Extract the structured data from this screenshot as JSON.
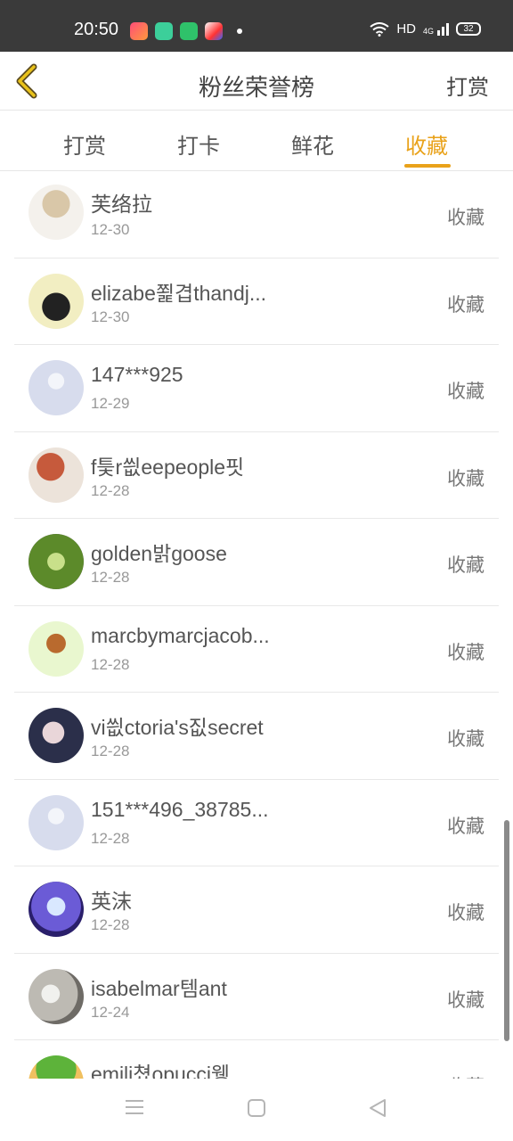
{
  "status_bar": {
    "time": "20:50",
    "network": "HD",
    "signal": "4G",
    "battery": "32",
    "app_icons": [
      "video-app-icon",
      "cart-app-icon",
      "circle-app-icon",
      "tiktok-app-icon"
    ]
  },
  "header": {
    "title": "粉丝荣誉榜",
    "action": "打赏"
  },
  "tabs": [
    {
      "label": "打赏",
      "active": false
    },
    {
      "label": "打卡",
      "active": false
    },
    {
      "label": "鲜花",
      "active": false
    },
    {
      "label": "收藏",
      "active": true
    }
  ],
  "accent_color": "#e9a21a",
  "list": [
    {
      "name": "芙络拉",
      "date": "12-30",
      "action": "收藏"
    },
    {
      "name": "elizabe쬝겹thandj...",
      "date": "12-30",
      "action": "收藏"
    },
    {
      "name": "147***925",
      "date": "12-29",
      "action": "收藏"
    },
    {
      "name": "f틏r씞eepeople핏",
      "date": "12-28",
      "action": "收藏"
    },
    {
      "name": "golden밝goose",
      "date": "12-28",
      "action": "收藏"
    },
    {
      "name": "marcbymarcjacob...",
      "date": "12-28",
      "action": "收藏"
    },
    {
      "name": "vi씞ctoria's짒secret",
      "date": "12-28",
      "action": "收藏"
    },
    {
      "name": "151***496_38785...",
      "date": "12-28",
      "action": "收藏"
    },
    {
      "name": "英沫",
      "date": "12-28",
      "action": "收藏"
    },
    {
      "name": "isabelmar템ant",
      "date": "12-24",
      "action": "收藏"
    },
    {
      "name": "emili쳤opucci웽",
      "date": "",
      "action": "收藏"
    }
  ]
}
